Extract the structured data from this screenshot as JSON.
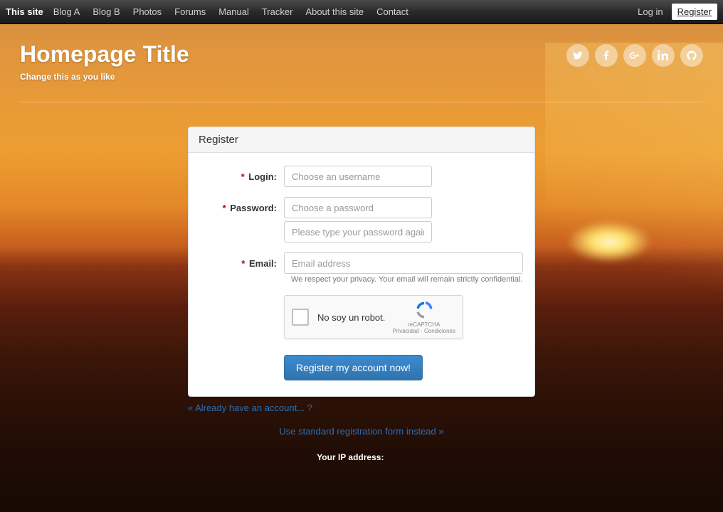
{
  "nav": {
    "brand": "This site",
    "items": [
      "Blog A",
      "Blog B",
      "Photos",
      "Forums",
      "Manual",
      "Tracker",
      "About this site",
      "Contact"
    ],
    "login": "Log in",
    "register": "Register"
  },
  "header": {
    "title": "Homepage Title",
    "tagline": "Change this as you like"
  },
  "card": {
    "title": "Register",
    "login_label": "Login:",
    "login_placeholder": "Choose an username",
    "password_label": "Password:",
    "password_placeholder": "Choose a password",
    "password2_placeholder": "Please type your password again",
    "email_label": "Email:",
    "email_placeholder": "Email address",
    "email_help": "We respect your privacy. Your email will remain strictly confidential.",
    "recaptcha_label": "No soy un robot.",
    "recaptcha_brand": "reCAPTCHA",
    "recaptcha_legal": "Privacidad · Condiciones",
    "submit": "Register my account now!"
  },
  "links": {
    "already": "« Already have an account... ?",
    "altform": "Use standard registration form instead »"
  },
  "footer": {
    "ip_label": "Your IP address:",
    "ip_value": " "
  }
}
